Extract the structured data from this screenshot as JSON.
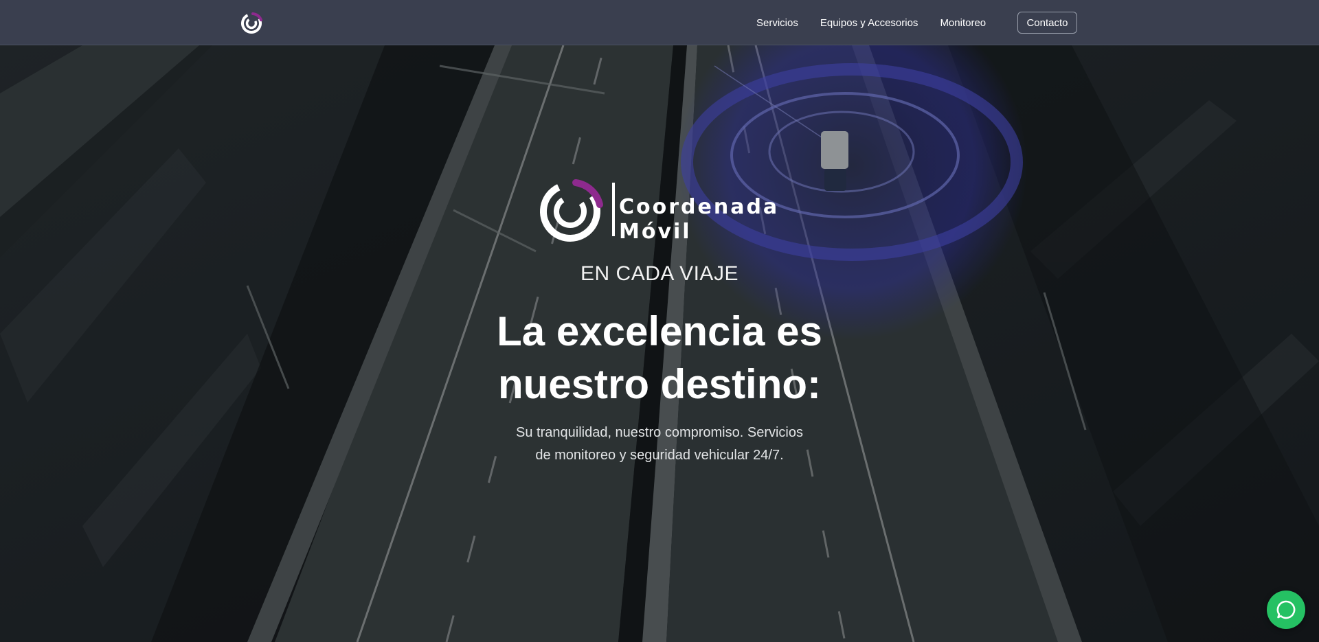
{
  "nav": {
    "logo_icon": "coordenada-movil-logo-icon",
    "links": [
      "Servicios",
      "Equipos y Accesorios",
      "Monitoreo"
    ],
    "contact_label": "Contacto"
  },
  "hero": {
    "brand_line1": "Coordenada",
    "brand_line2": "Móvil",
    "eyebrow": "EN CADA VIAJE",
    "headline_line1": "La excelencia es",
    "headline_line2": "nuestro destino:",
    "subtext_line1": "Su tranquilidad, nuestro compromiso. Servicios",
    "subtext_line2": "de monitoreo y seguridad vehicular 24/7."
  },
  "floating": {
    "whatsapp_icon": "whatsapp-chat-icon"
  },
  "colors": {
    "navbar_bg": "#3a3f4f",
    "brand_purple": "#8e2a8e",
    "whatsapp_green": "#25c163",
    "radar_blue": "#3f3fe6"
  }
}
